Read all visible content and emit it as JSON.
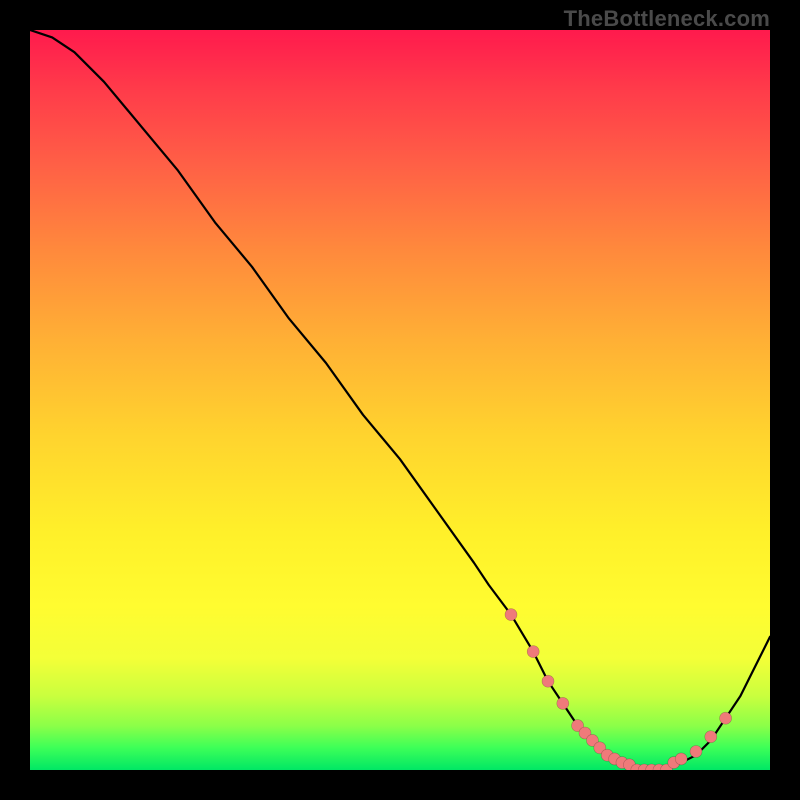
{
  "watermark": "TheBottleneck.com",
  "colors": {
    "frame": "#000000",
    "curve": "#000000",
    "dot": "#ef7a7a",
    "gradient_stops": [
      "#ff1a4d",
      "#ff8a3c",
      "#fff02a",
      "#00e765"
    ]
  },
  "chart_data": {
    "type": "line",
    "title": "",
    "xlabel": "",
    "ylabel": "",
    "xlim": [
      0,
      100
    ],
    "ylim": [
      0,
      100
    ],
    "grid": false,
    "legend": false,
    "series": [
      {
        "name": "bottleneck-curve",
        "x": [
          0,
          3,
          6,
          10,
          15,
          20,
          25,
          30,
          35,
          40,
          45,
          50,
          55,
          60,
          62,
          65,
          68,
          70,
          72,
          74,
          76,
          78,
          80,
          82,
          84,
          86,
          88,
          90,
          92,
          94,
          96,
          98,
          100
        ],
        "y": [
          100,
          99,
          97,
          93,
          87,
          81,
          74,
          68,
          61,
          55,
          48,
          42,
          35,
          28,
          25,
          21,
          16,
          12,
          9,
          6,
          4,
          2,
          1,
          0,
          0,
          0,
          1,
          2,
          4,
          7,
          10,
          14,
          18
        ]
      }
    ],
    "highlight_points": {
      "name": "optimal-zone-dots",
      "x": [
        65,
        68,
        70,
        72,
        74,
        75,
        76,
        77,
        78,
        79,
        80,
        81,
        82,
        83,
        84,
        85,
        86,
        87,
        88,
        90,
        92,
        94
      ],
      "y": [
        21,
        16,
        12,
        9,
        6,
        5,
        4,
        3,
        2,
        1.5,
        1,
        0.7,
        0,
        0,
        0,
        0,
        0,
        1,
        1.5,
        2.5,
        4.5,
        7
      ]
    }
  }
}
